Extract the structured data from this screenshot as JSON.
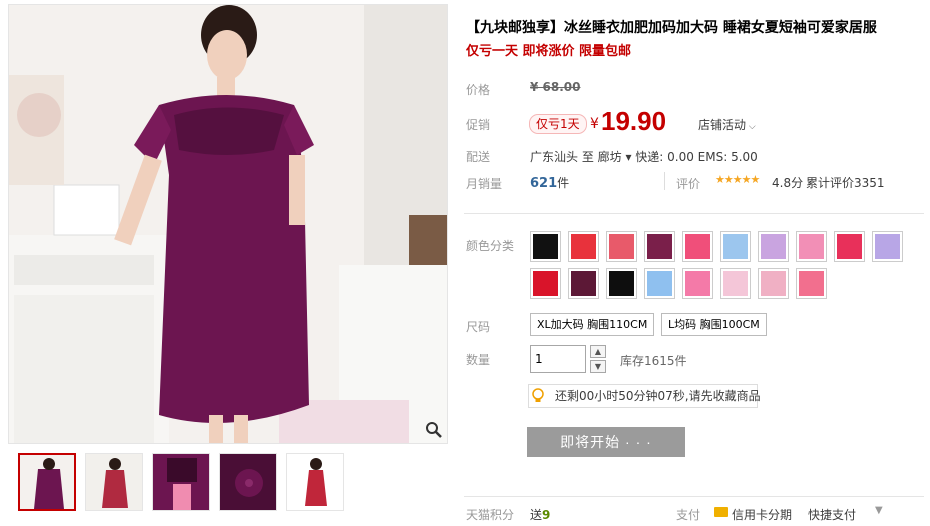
{
  "product": {
    "title": "【九块邮独享】冰丝睡衣加肥加码加大码 睡裙女夏短袖可爱家居服",
    "subtitle": "仅亏一天 即将涨价 限量包邮"
  },
  "labels": {
    "price": "价格",
    "promo": "促销",
    "shipping": "配送",
    "monthly_sales": "月销量",
    "rating": "评价",
    "color": "颜色分类",
    "size": "尺码",
    "quantity": "数量",
    "points": "天猫积分",
    "payment": "支付"
  },
  "pricing": {
    "original": "¥ 68.00",
    "promo_badge": "仅亏1天",
    "currency": "¥",
    "current": "19.90",
    "store_activity": "店铺活动"
  },
  "shipping": {
    "text": "广东汕头  至  廊坊 ▾   快递: 0.00 EMS: 5.00"
  },
  "sales": {
    "count": "621",
    "unit": "件",
    "stars": "★★★★★",
    "score": "4.8分",
    "total_reviews": "累计评价3351"
  },
  "colors": {
    "swatches": [
      "#111111",
      "#e8323c",
      "#e85a6a",
      "#7a1f4a",
      "#f04f7a",
      "#9cc6ee",
      "#c9a4e0",
      "#f28fb6",
      "#e8305a",
      "#b8a6e6",
      "#d9142a",
      "#5c1836",
      "#0e0e0e",
      "#8fc0ef",
      "#f47aa8",
      "#f4c6d8",
      "#f0b0c4",
      "#f26f8e"
    ]
  },
  "sizes": [
    "XL加大码 胸围110CM",
    "L均码 胸围100CM"
  ],
  "quantity": {
    "value": "1",
    "up": "▲",
    "down": "▼",
    "stock": "库存1615件"
  },
  "countdown": "还剩00小时50分钟07秒,请先收藏商品",
  "buy_button": "即将开始 · · ·",
  "points": {
    "prefix": "送",
    "value": "9"
  },
  "payment": {
    "card": "信用卡分期",
    "quick": "快捷支付",
    "arrow": "▼"
  }
}
